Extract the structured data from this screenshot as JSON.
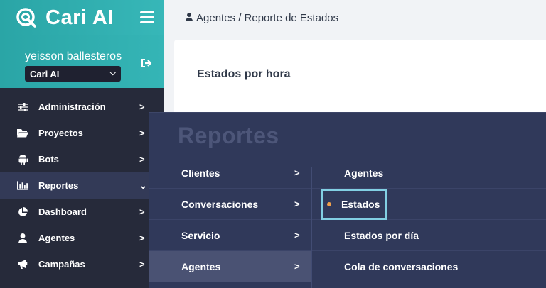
{
  "brand": {
    "name": "Cari AI",
    "logo_icon": "cari-logo-icon",
    "accent_color": "#2aa5a6"
  },
  "user": {
    "name": "yeisson ballesteros",
    "org_selected": "Cari AI"
  },
  "sidebar": {
    "items": [
      {
        "label": "Administración",
        "icon": "sliders-icon",
        "arrow": ">"
      },
      {
        "label": "Proyectos",
        "icon": "folder-icon",
        "arrow": ">"
      },
      {
        "label": "Bots",
        "icon": "android-icon",
        "arrow": ">"
      },
      {
        "label": "Reportes",
        "icon": "bar-chart-icon",
        "arrow": "⌄"
      },
      {
        "label": "Dashboard",
        "icon": "pie-chart-icon",
        "arrow": ">"
      },
      {
        "label": "Agentes",
        "icon": "user-icon",
        "arrow": ">"
      },
      {
        "label": "Campañas",
        "icon": "megaphone-icon",
        "arrow": ">"
      }
    ]
  },
  "breadcrumb": {
    "text": "Agentes / Reporte de Estados"
  },
  "card": {
    "title": "Estados por hora"
  },
  "flyout": {
    "title": "Reportes",
    "left_items": [
      {
        "label": "Clientes",
        "arrow": ">"
      },
      {
        "label": "Conversaciones",
        "arrow": ">"
      },
      {
        "label": "Servicio",
        "arrow": ">"
      },
      {
        "label": "Agentes",
        "arrow": ">"
      }
    ],
    "right_items": [
      {
        "label": "Agentes"
      },
      {
        "label": "Estados"
      },
      {
        "label": "Estados por día"
      },
      {
        "label": "Cola de conversaciones"
      }
    ]
  }
}
